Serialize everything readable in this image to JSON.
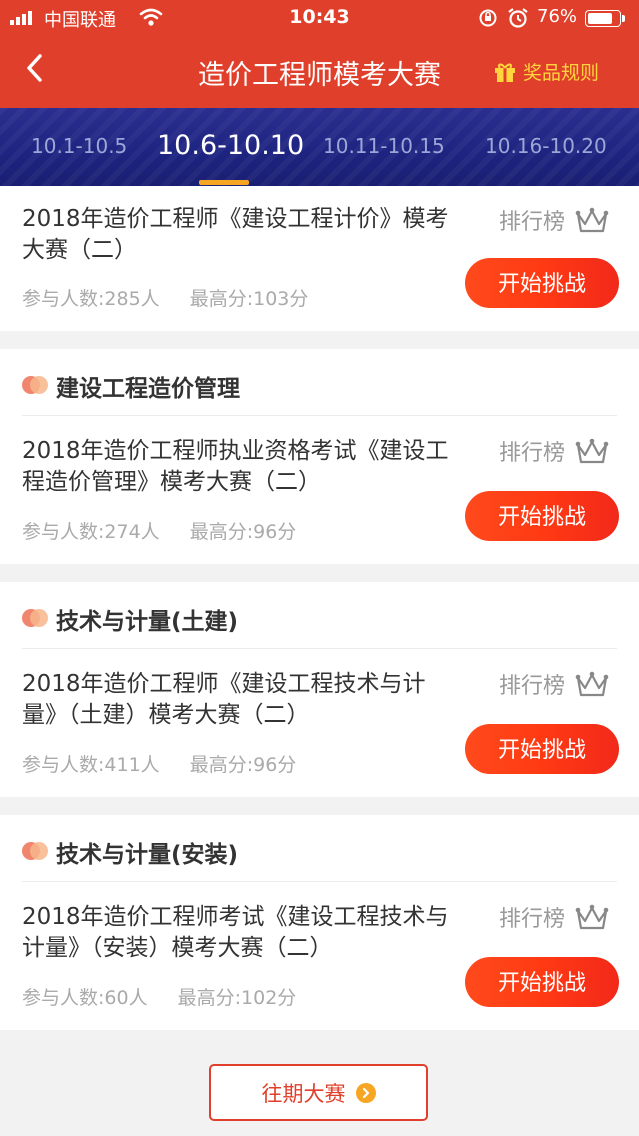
{
  "status": {
    "carrier": "中国联通",
    "time": "10:43",
    "battery": "76%"
  },
  "nav": {
    "title": "造价工程师模考大赛",
    "rules_label": "奖品规则"
  },
  "tabs": [
    {
      "label": "10.1-10.5"
    },
    {
      "label": "10.6-10.10"
    },
    {
      "label": "10.11-10.15"
    },
    {
      "label": "10.16-10.20"
    }
  ],
  "active_tab": "10.6-10.10",
  "cards": [
    {
      "section": "",
      "title": "2018年造价工程师《建设工程计价》模考大赛（二）",
      "participants": "参与人数:285人",
      "high_score": "最高分:103分",
      "rank_label": "排行榜",
      "button": "开始挑战"
    },
    {
      "section": "建设工程造价管理",
      "title": "2018年造价工程师执业资格考试《建设工程造价管理》模考大赛（二）",
      "participants": "参与人数:274人",
      "high_score": "最高分:96分",
      "rank_label": "排行榜",
      "button": "开始挑战"
    },
    {
      "section": "技术与计量(土建)",
      "title": "2018年造价工程师《建设工程技术与计量》（土建）模考大赛（二）",
      "participants": "参与人数:411人",
      "high_score": "最高分:96分",
      "rank_label": "排行榜",
      "button": "开始挑战"
    },
    {
      "section": "技术与计量(安装)",
      "title": "2018年造价工程师考试《建设工程技术与计量》（安装）模考大赛（二）",
      "participants": "参与人数:60人",
      "high_score": "最高分:102分",
      "rank_label": "排行榜",
      "button": "开始挑战"
    }
  ],
  "past_label": "往期大赛",
  "colors": {
    "brand_red": "#e0402b",
    "tab_bg": "#1d2480",
    "accent_orange": "#f6a623",
    "button_red": "#ff3a13"
  }
}
